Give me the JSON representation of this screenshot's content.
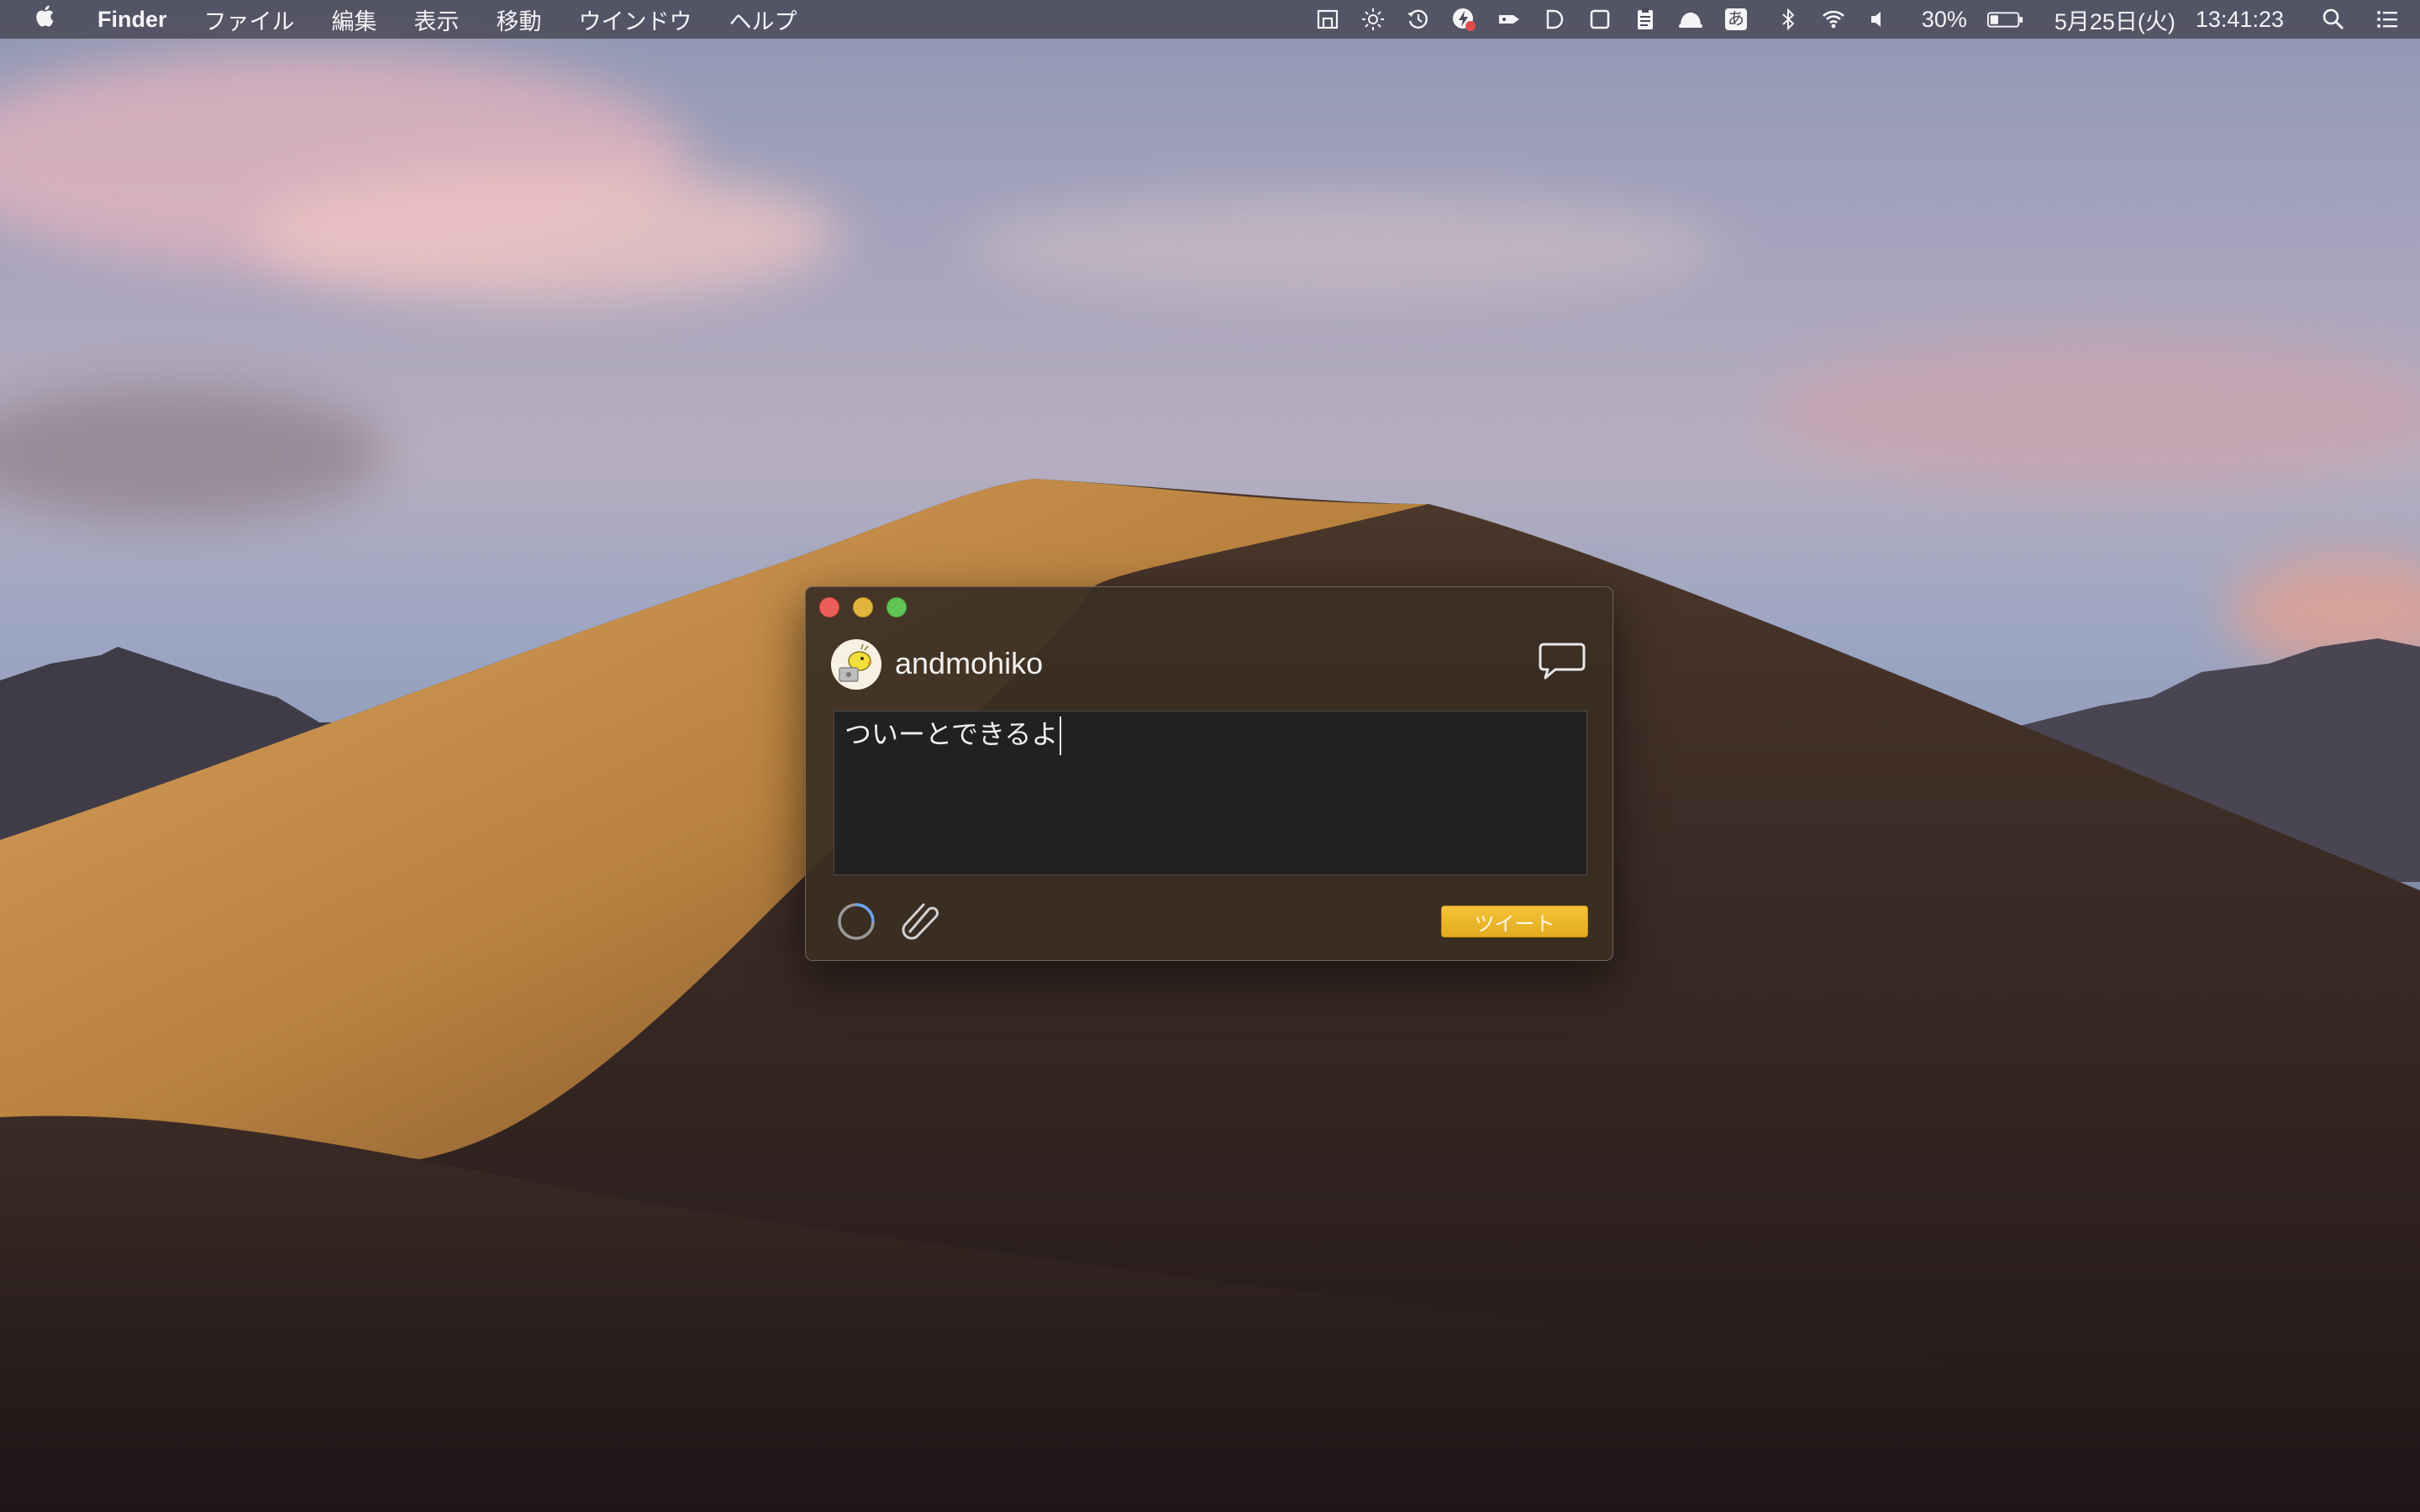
{
  "menubar": {
    "apple_icon": "apple-icon",
    "app_name": "Finder",
    "menus": [
      "ファイル",
      "編集",
      "表示",
      "移動",
      "ウインドウ",
      "ヘルプ"
    ],
    "status_icons": [
      "display-icon",
      "brightness-icon",
      "timemachine-icon",
      "notification-icon",
      "tag-icon",
      "d-icon",
      "square-icon",
      "clipboard-icon",
      "cloud-icon",
      "input-method-icon",
      "bluetooth-icon",
      "wifi-icon",
      "volume-icon"
    ],
    "input_method_label": "あ",
    "battery_percent": "30%",
    "battery_level": 0.3,
    "date": "5月25日(火)",
    "time": "13:41:23",
    "search_icon": "search-icon",
    "notification_center_icon": "list-icon"
  },
  "tweet_window": {
    "username": "andmohiko",
    "text": "ついーとできるよ",
    "tweet_button_label": "ツイート",
    "compose_icon": "speech-bubble-icon",
    "attach_icon": "paperclip-icon",
    "progress_icon": "spinner-icon"
  }
}
